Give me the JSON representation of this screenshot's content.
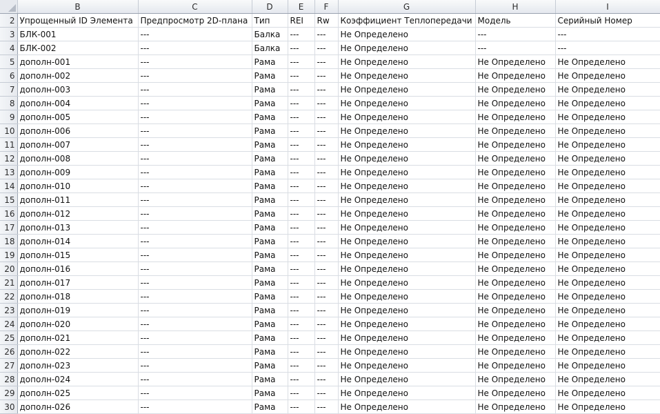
{
  "columns": [
    {
      "letter": "B"
    },
    {
      "letter": "C"
    },
    {
      "letter": "D"
    },
    {
      "letter": "E"
    },
    {
      "letter": "F"
    },
    {
      "letter": "G"
    },
    {
      "letter": "H"
    },
    {
      "letter": "I"
    }
  ],
  "rows": [
    {
      "n": "2",
      "cells": [
        "Упрощенный ID Элемента",
        "Предпросмотр 2D-плана",
        "Тип",
        "REI",
        "Rw",
        "Коэффициент Теплопередачи",
        "Модель",
        "Серийный Номер"
      ]
    },
    {
      "n": "3",
      "cells": [
        "БЛК-001",
        "---",
        "Балка",
        "---",
        "---",
        "Не Определено",
        "---",
        "---"
      ]
    },
    {
      "n": "4",
      "cells": [
        "БЛК-002",
        "---",
        "Балка",
        "---",
        "---",
        "Не Определено",
        "---",
        "---"
      ]
    },
    {
      "n": "5",
      "cells": [
        "дополн-001",
        "---",
        "Рама",
        "---",
        "---",
        "Не Определено",
        "Не Определено",
        "Не Определено"
      ]
    },
    {
      "n": "6",
      "cells": [
        "дополн-002",
        "---",
        "Рама",
        "---",
        "---",
        "Не Определено",
        "Не Определено",
        "Не Определено"
      ]
    },
    {
      "n": "7",
      "cells": [
        "дополн-003",
        "---",
        "Рама",
        "---",
        "---",
        "Не Определено",
        "Не Определено",
        "Не Определено"
      ]
    },
    {
      "n": "8",
      "cells": [
        "дополн-004",
        "---",
        "Рама",
        "---",
        "---",
        "Не Определено",
        "Не Определено",
        "Не Определено"
      ]
    },
    {
      "n": "9",
      "cells": [
        "дополн-005",
        "---",
        "Рама",
        "---",
        "---",
        "Не Определено",
        "Не Определено",
        "Не Определено"
      ]
    },
    {
      "n": "10",
      "cells": [
        "дополн-006",
        "---",
        "Рама",
        "---",
        "---",
        "Не Определено",
        "Не Определено",
        "Не Определено"
      ]
    },
    {
      "n": "11",
      "cells": [
        "дополн-007",
        "---",
        "Рама",
        "---",
        "---",
        "Не Определено",
        "Не Определено",
        "Не Определено"
      ]
    },
    {
      "n": "12",
      "cells": [
        "дополн-008",
        "---",
        "Рама",
        "---",
        "---",
        "Не Определено",
        "Не Определено",
        "Не Определено"
      ]
    },
    {
      "n": "13",
      "cells": [
        "дополн-009",
        "---",
        "Рама",
        "---",
        "---",
        "Не Определено",
        "Не Определено",
        "Не Определено"
      ]
    },
    {
      "n": "14",
      "cells": [
        "дополн-010",
        "---",
        "Рама",
        "---",
        "---",
        "Не Определено",
        "Не Определено",
        "Не Определено"
      ]
    },
    {
      "n": "15",
      "cells": [
        "дополн-011",
        "---",
        "Рама",
        "---",
        "---",
        "Не Определено",
        "Не Определено",
        "Не Определено"
      ]
    },
    {
      "n": "16",
      "cells": [
        "дополн-012",
        "---",
        "Рама",
        "---",
        "---",
        "Не Определено",
        "Не Определено",
        "Не Определено"
      ]
    },
    {
      "n": "17",
      "cells": [
        "дополн-013",
        "---",
        "Рама",
        "---",
        "---",
        "Не Определено",
        "Не Определено",
        "Не Определено"
      ]
    },
    {
      "n": "18",
      "cells": [
        "дополн-014",
        "---",
        "Рама",
        "---",
        "---",
        "Не Определено",
        "Не Определено",
        "Не Определено"
      ]
    },
    {
      "n": "19",
      "cells": [
        "дополн-015",
        "---",
        "Рама",
        "---",
        "---",
        "Не Определено",
        "Не Определено",
        "Не Определено"
      ]
    },
    {
      "n": "20",
      "cells": [
        "дополн-016",
        "---",
        "Рама",
        "---",
        "---",
        "Не Определено",
        "Не Определено",
        "Не Определено"
      ]
    },
    {
      "n": "21",
      "cells": [
        "дополн-017",
        "---",
        "Рама",
        "---",
        "---",
        "Не Определено",
        "Не Определено",
        "Не Определено"
      ]
    },
    {
      "n": "22",
      "cells": [
        "дополн-018",
        "---",
        "Рама",
        "---",
        "---",
        "Не Определено",
        "Не Определено",
        "Не Определено"
      ]
    },
    {
      "n": "23",
      "cells": [
        "дополн-019",
        "---",
        "Рама",
        "---",
        "---",
        "Не Определено",
        "Не Определено",
        "Не Определено"
      ]
    },
    {
      "n": "24",
      "cells": [
        "дополн-020",
        "---",
        "Рама",
        "---",
        "---",
        "Не Определено",
        "Не Определено",
        "Не Определено"
      ]
    },
    {
      "n": "25",
      "cells": [
        "дополн-021",
        "---",
        "Рама",
        "---",
        "---",
        "Не Определено",
        "Не Определено",
        "Не Определено"
      ]
    },
    {
      "n": "26",
      "cells": [
        "дополн-022",
        "---",
        "Рама",
        "---",
        "---",
        "Не Определено",
        "Не Определено",
        "Не Определено"
      ]
    },
    {
      "n": "27",
      "cells": [
        "дополн-023",
        "---",
        "Рама",
        "---",
        "---",
        "Не Определено",
        "Не Определено",
        "Не Определено"
      ]
    },
    {
      "n": "28",
      "cells": [
        "дополн-024",
        "---",
        "Рама",
        "---",
        "---",
        "Не Определено",
        "Не Определено",
        "Не Определено"
      ]
    },
    {
      "n": "29",
      "cells": [
        "дополн-025",
        "---",
        "Рама",
        "---",
        "---",
        "Не Определено",
        "Не Определено",
        "Не Определено"
      ]
    },
    {
      "n": "30",
      "cells": [
        "дополн-026",
        "---",
        "Рама",
        "---",
        "---",
        "Не Определено",
        "Не Определено",
        "Не Определено"
      ]
    }
  ]
}
